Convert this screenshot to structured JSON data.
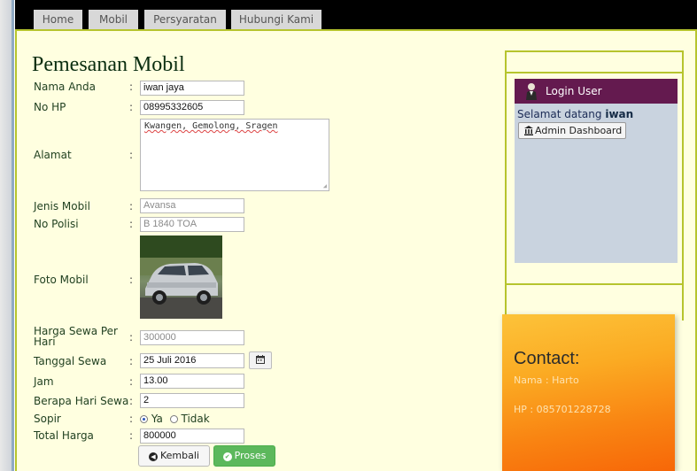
{
  "nav": {
    "items": [
      "Home",
      "Mobil",
      "Persyaratan",
      "Hubungi Kami"
    ]
  },
  "form": {
    "title": "Pemesanan Mobil",
    "colon": ":",
    "fields": {
      "nama": {
        "label": "Nama Anda",
        "value": "iwan jaya"
      },
      "hp": {
        "label": "No HP",
        "value": "08995332605"
      },
      "alamat": {
        "label": "Alamat",
        "value": "Kwangen, Gemolong, Sragen"
      },
      "jenis": {
        "label": "Jenis Mobil",
        "value": "Avansa"
      },
      "polisi": {
        "label": "No Polisi",
        "value": "B 1840 TOA"
      },
      "foto": {
        "label": "Foto Mobil"
      },
      "harga": {
        "label": "Harga Sewa Per Hari",
        "value": "300000"
      },
      "tanggal": {
        "label": "Tanggal Sewa",
        "value": "25 Juli 2016"
      },
      "jam": {
        "label": "Jam",
        "value": "13.00"
      },
      "hari": {
        "label": "Berapa Hari Sewa",
        "value": "2"
      },
      "sopir": {
        "label": "Sopir",
        "option_yes": "Ya",
        "option_no": "Tidak",
        "selected": "Ya"
      },
      "total": {
        "label": "Total Harga",
        "value": "800000"
      }
    },
    "buttons": {
      "back": "Kembali",
      "process": "Proses"
    }
  },
  "sidebar": {
    "login_title": "Login User",
    "welcome_prefix": "Selamat datang",
    "username": "iwan",
    "admin_button": "Admin Dashboard"
  },
  "contact": {
    "title": "Contact:",
    "name_line": "Nama : Harto",
    "phone_line": "HP : 085701228728"
  },
  "colors": {
    "page_bg": "#ffffe0",
    "border_accent": "#b6c42e",
    "login_header": "#641a4f",
    "success": "#5cb85c",
    "contact_orange": "#f98412"
  },
  "icons": [
    "calendar-icon",
    "chevron-left-icon",
    "check-icon",
    "user-icon",
    "bank-icon",
    "resize-grip-icon"
  ]
}
